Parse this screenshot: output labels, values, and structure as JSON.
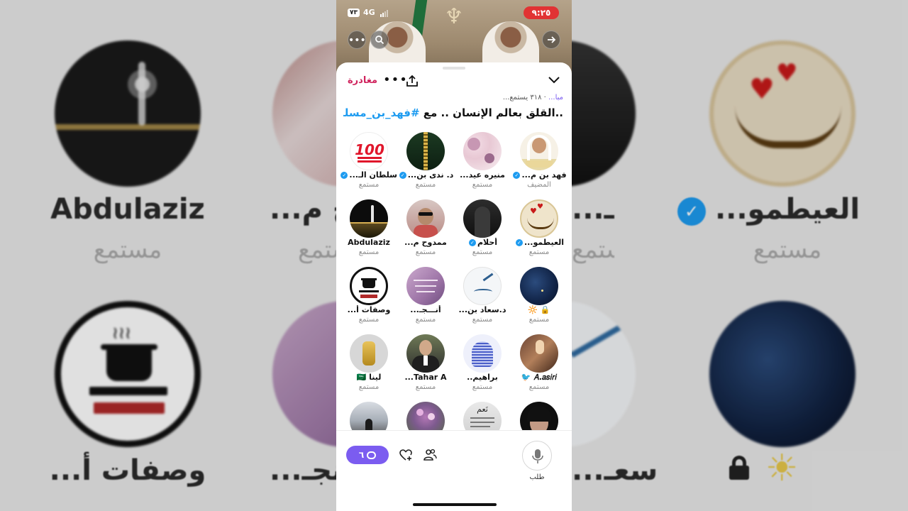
{
  "status_bar": {
    "time": "٩:٢٥",
    "battery": "٧٣",
    "network": "4G"
  },
  "sheet": {
    "leave_label": "مغادرة",
    "meta_live": "مبا...",
    "meta_count": "٣١٨ يستمع...",
    "title_text": "..القلق بعالم الإنسان .. مع ",
    "title_tag": "#فهد_بن_مسلم"
  },
  "participants": [
    {
      "name": "فهد بن م...",
      "verified": true,
      "role": "المضيف",
      "avatar": "host-avatar"
    },
    {
      "name": "منيره عيد...",
      "verified": false,
      "role": "مستمع",
      "avatar": "floral-avatar"
    },
    {
      "name": "د. ندى بن...",
      "verified": true,
      "role": "مستمع",
      "avatar": "zipper-avatar"
    },
    {
      "name": "سلطان الـ...",
      "verified": true,
      "role": "مستمع",
      "avatar": "hundred-emoji-avatar"
    },
    {
      "name": "العيطمو...",
      "verified": true,
      "role": "مستمع",
      "avatar": "calligraphy-avatar"
    },
    {
      "name": "أحلام",
      "verified": true,
      "role": "مستمع",
      "avatar": "dark-figure-avatar"
    },
    {
      "name": "ممدوح م...",
      "verified": false,
      "role": "مستمع",
      "avatar": "man-avatar"
    },
    {
      "name": "Abdulaziz",
      "verified": false,
      "role": "مستمع",
      "avatar": "fountain-avatar"
    },
    {
      "name": "🔒 🔆",
      "verified": false,
      "role": "مستمع",
      "avatar": "night-sky-avatar"
    },
    {
      "name": "د.سعاد بن...",
      "verified": false,
      "role": "مستمع",
      "avatar": "book-avatar"
    },
    {
      "name": "أنـــجـ...",
      "verified": false,
      "role": "مستمع",
      "avatar": "purple-quote-avatar"
    },
    {
      "name": "وصفات أ...",
      "verified": false,
      "role": "مستمع",
      "avatar": "cooking-pot-avatar"
    },
    {
      "name": "𝐴.𝑎𝑠𝑖𝑟𝑖 🐦",
      "verified": false,
      "role": "مستمع",
      "avatar": "room-avatar"
    },
    {
      "name": "براهيم..",
      "verified": false,
      "role": "مستمع",
      "avatar": "blue-sketch-avatar"
    },
    {
      "name": "Tahar A...",
      "verified": false,
      "role": "مستمع",
      "avatar": "suit-man-avatar"
    },
    {
      "name": "لينا 🇸🇦",
      "verified": false,
      "role": "مستمع",
      "avatar": "gold-pendant-avatar"
    },
    {
      "name": "",
      "verified": false,
      "role": "",
      "avatar": "dark-hair-avatar"
    },
    {
      "name": "",
      "verified": false,
      "role": "",
      "avatar": "note-avatar"
    },
    {
      "name": "",
      "verified": false,
      "role": "",
      "avatar": "flowers-avatar"
    },
    {
      "name": "",
      "verified": false,
      "role": "",
      "avatar": "mountain-avatar"
    }
  ],
  "note_avatar_text": "نَعم",
  "bottom_bar": {
    "comment_count": "٦",
    "request_label": "طلب"
  },
  "background": {
    "names": [
      "Abdulaziz",
      "مستمع",
      "مستمع",
      "...العيطمو",
      "مستمع",
      "...وصفات أ",
      "...د.سعـ",
      "...حـ ح م",
      "...أحـ",
      "...نجـ"
    ]
  },
  "colors": {
    "accent": "#7b5cf0",
    "leave": "#d0245e",
    "link": "#1d9bf0",
    "verified": "#1d9bf0",
    "live_badge": "#e13333"
  }
}
